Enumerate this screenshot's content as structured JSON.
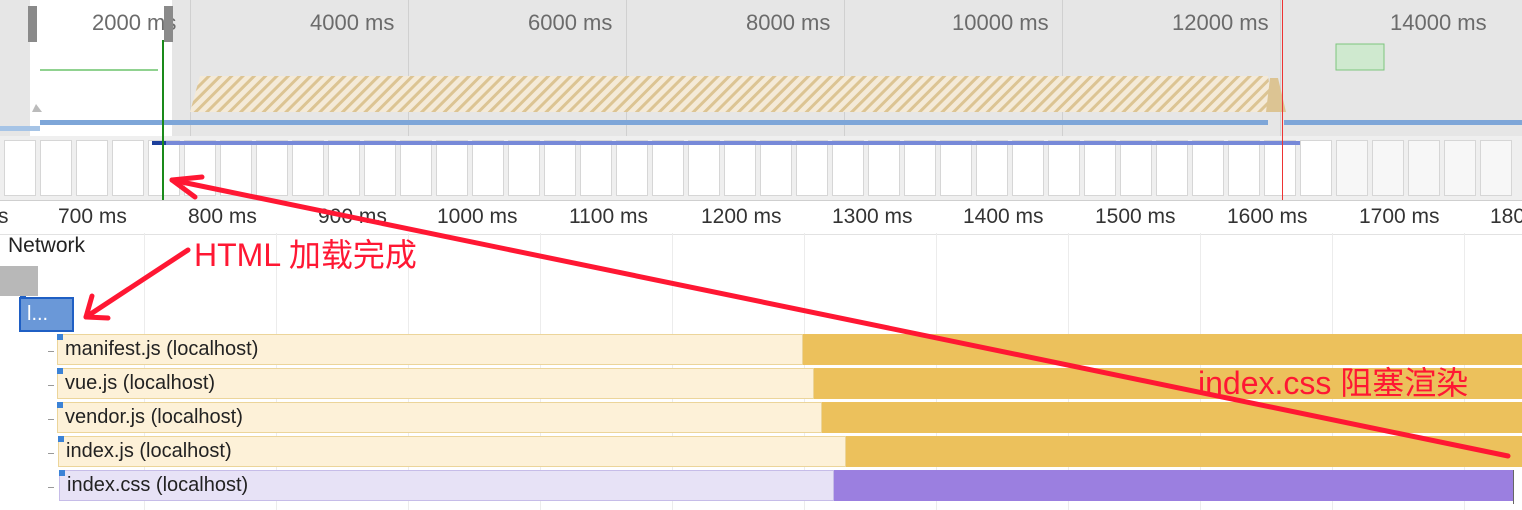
{
  "overview": {
    "time_labels": [
      "2000 ms",
      "4000 ms",
      "6000 ms",
      "8000 ms",
      "10000 ms",
      "12000 ms",
      "14000 ms"
    ]
  },
  "ruler": {
    "labels": [
      "s",
      "700 ms",
      "800 ms",
      "900 ms",
      "1000 ms",
      "1100 ms",
      "1200 ms",
      "1300 ms",
      "1400 ms",
      "1500 ms",
      "1600 ms",
      "1700 ms",
      "180"
    ]
  },
  "network": {
    "section_title": "Network",
    "collapsed_request": "l...",
    "requests": [
      {
        "name": "manifest.js (localhost)",
        "type": "script"
      },
      {
        "name": "vue.js (localhost)",
        "type": "script"
      },
      {
        "name": "vendor.js (localhost)",
        "type": "script"
      },
      {
        "name": "index.js (localhost)",
        "type": "script"
      },
      {
        "name": "index.css (localhost)",
        "type": "stylesheet"
      }
    ]
  },
  "annotations": {
    "html_loaded": "HTML 加载完成",
    "css_blocking": "index.css 阻塞渲染"
  },
  "colors": {
    "script_wait": "#fdf1d8",
    "script_download": "#ecc15c",
    "css_wait": "#e7e2f6",
    "css_download": "#9b7fe0",
    "annotation": "#ff1733",
    "selected_request": "#6a98d8"
  }
}
